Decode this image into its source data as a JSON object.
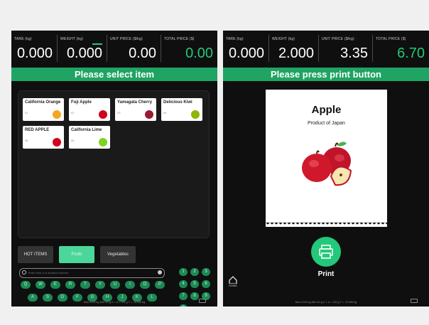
{
  "left": {
    "stats": [
      {
        "label": "TARE (kg)",
        "value": "0.000"
      },
      {
        "label": "WEIGHT (kg)",
        "value": "0.000"
      },
      {
        "label": "UNIT PRICE ($/kg)",
        "value": "0.00"
      },
      {
        "label": "TOTAL PRICE ($)",
        "value": "0.00"
      }
    ],
    "banner": "Please select item",
    "items": [
      {
        "name": "California Orange",
        "code": "01",
        "color": "#f5a623"
      },
      {
        "name": "Fuji Apple",
        "code": "02",
        "color": "#d0021b"
      },
      {
        "name": "Yamagata Cherry",
        "code": "03",
        "color": "#9b1b30"
      },
      {
        "name": "Delicious Kiwi",
        "code": "04",
        "color": "#8db600"
      },
      {
        "name": "RED APPLE",
        "code": "05",
        "color": "#d0021b"
      },
      {
        "name": "California Lime",
        "code": "06",
        "color": "#7ed321"
      }
    ],
    "tabs": [
      "HOT ITEMS",
      "Fruits",
      "Vegetables"
    ],
    "search_placeholder": "Enter item or a shortcut number",
    "letters_row1": [
      "Q",
      "W",
      "E",
      "R",
      "T",
      "Y",
      "U",
      "I",
      "O",
      "P"
    ],
    "letters_row2": [
      "A",
      "S",
      "D",
      "F",
      "G",
      "H",
      "J",
      "K",
      "L"
    ],
    "letters_row3": [
      "Z",
      "X",
      "C",
      "V",
      "B",
      "N",
      "M"
    ],
    "numpad": [
      "1",
      "2",
      "3",
      "4",
      "5",
      "6",
      "7",
      "8",
      "9",
      "0"
    ],
    "footer": "Max 6/15 kg  Min 40 g  e = d = 2/5 g  T = -5.998 kg"
  },
  "right": {
    "stats": [
      {
        "label": "TARE (kg)",
        "value": "0.000"
      },
      {
        "label": "WEIGHT (kg)",
        "value": "2.000"
      },
      {
        "label": "UNIT PRICE ($/kg)",
        "value": "3.35"
      },
      {
        "label": "TOTAL PRICE ($)",
        "value": "6.70"
      }
    ],
    "banner": "Please press print button",
    "receipt_title": "Apple",
    "receipt_subtitle": "Product of Japan",
    "print_label": "Print",
    "home_label": "HOME",
    "footer": "Max 6/15 kg  Min 40 g  e = d = 2/5 g  T = -5.998 kg"
  },
  "colors": {
    "accent": "#22c97a",
    "banner": "#1fa463",
    "screen_bg": "#0f0f0f"
  }
}
